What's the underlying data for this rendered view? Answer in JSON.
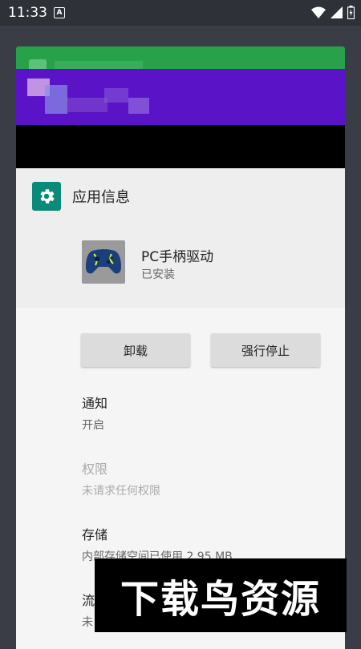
{
  "status_bar": {
    "time": "11:33",
    "notif_letter": "A"
  },
  "app_info": {
    "title": "应用信息",
    "app_name": "PC手柄驱动",
    "install_status": "已安装",
    "buttons": {
      "uninstall": "卸载",
      "force_stop": "强行停止"
    },
    "settings": [
      {
        "title": "通知",
        "subtitle": "开启"
      },
      {
        "title": "权限",
        "subtitle": "未请求任何权限"
      },
      {
        "title": "存储",
        "subtitle": "内部存储空间已使用 2.95 MB"
      },
      {
        "title": "流",
        "subtitle": "未"
      }
    ]
  },
  "watermark": "下载鸟资源",
  "colors": {
    "green_card": "#27a24a",
    "purple_card": "#5a13c7",
    "accent": "#0a8a7a"
  }
}
